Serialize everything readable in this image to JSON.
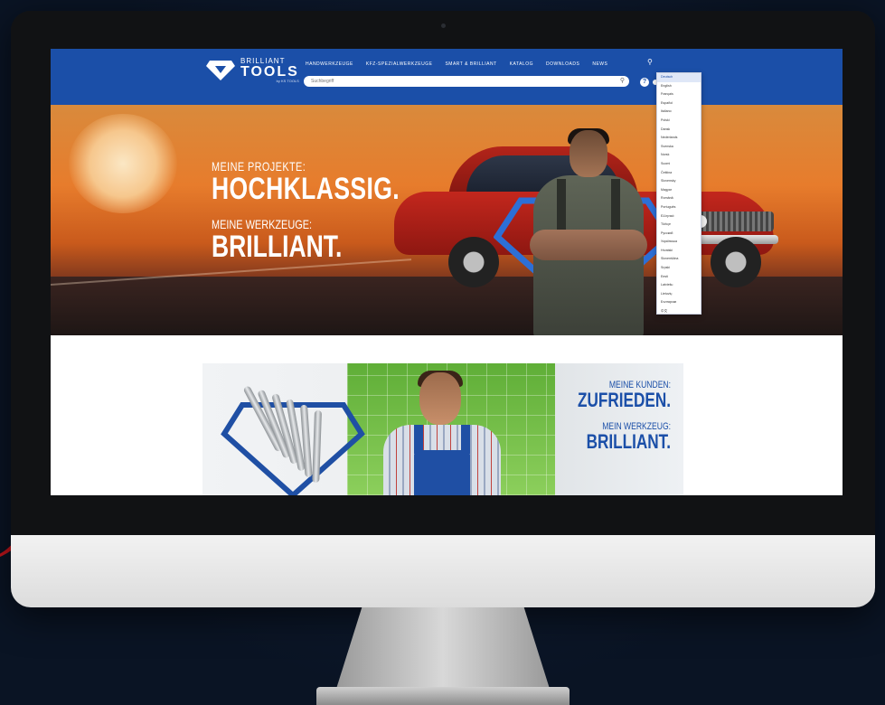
{
  "brand": {
    "line1": "BRILLIANT",
    "line2": "TOOLS",
    "line3": "by KS TOOLS",
    "blue": "#1b4fa8"
  },
  "nav": {
    "items": [
      "HANDWERKZEUGE",
      "KFZ-SPEZIALWERKZEUGE",
      "SMART & BRILLIANT",
      "KATALOG",
      "DOWNLOADS",
      "NEWS"
    ]
  },
  "search": {
    "placeholder": "Suchbegriff"
  },
  "hero": {
    "kicker1": "MEINE PROJEKTE:",
    "big1": "HOCHKLASSIG.",
    "kicker2": "MEINE WERKZEUGE:",
    "big2": "BRILLIANT."
  },
  "language_dropdown": {
    "items": [
      "Deutsch",
      "English",
      "Français",
      "Español",
      "Italiano",
      "Polski",
      "Dansk",
      "Nederlands",
      "Svenska",
      "Norsk",
      "Suomi",
      "Čeština",
      "Slovensky",
      "Magyar",
      "Română",
      "Português",
      "Ελληνικά",
      "Türkçe",
      "Русский",
      "Українська",
      "Hrvatski",
      "Slovenščina",
      "Srpski",
      "Eesti",
      "Latviešu",
      "Lietuvių",
      "Български",
      "中文"
    ]
  },
  "banner2": {
    "kicker1": "MEINE KUNDEN:",
    "big1": "ZUFRIEDEN.",
    "kicker2": "MEIN WERKZEUG:",
    "big2": "BRILLIANT."
  }
}
